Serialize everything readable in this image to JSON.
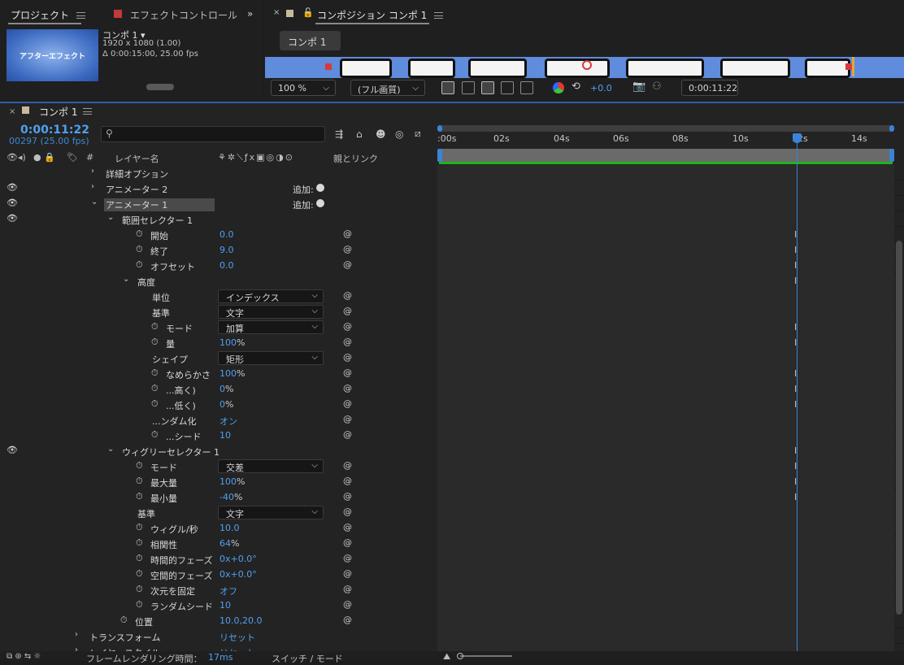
{
  "top_left": {
    "tab_project": "プロジェクト",
    "tab_effect_controls": "エフェクトコントロール",
    "effect_color": "#c23b3b",
    "thumbnail_text": "アフターエフェクト",
    "comp_name": "コンポ 1 ▾",
    "comp_size": "1920 x 1080 (1.00)",
    "comp_duration": "Δ 0:00:15:00, 25.00 fps"
  },
  "viewer": {
    "tab_close": "×",
    "tab_label": "コンポジション コンポ 1",
    "comp_button": "コンポ 1",
    "zoom": "100 %",
    "quality": "(フル画質)",
    "exposure": "+0.0",
    "timecode": "0:00:11:22"
  },
  "timeline": {
    "tab_close": "×",
    "tab_label": "コンポ 1",
    "timecode": "0:00:11:22",
    "frames": "00297 (25.00 fps)",
    "search_icon": "search-icon",
    "headers": {
      "layer_name": "レイヤー名",
      "hash": "#",
      "parent_link": "親とリンク"
    },
    "ruler_labels": [
      ":00s",
      "02s",
      "04s",
      "06s",
      "08s",
      "10s",
      "12s",
      "14s"
    ],
    "playhead_seconds": 11.88
  },
  "rows": {
    "r0": {
      "name": "詳細オプション"
    },
    "r1": {
      "name": "アニメーター 2",
      "add": "追加:"
    },
    "r2": {
      "name": "アニメーター 1",
      "add": "追加:"
    },
    "r3": {
      "name": "範囲セレクター 1"
    },
    "r4": {
      "name": "開始",
      "value": "0.0"
    },
    "r5": {
      "name": "終了",
      "value": "9.0"
    },
    "r6": {
      "name": "オフセット",
      "value": "0.0"
    },
    "r7": {
      "name": "高度"
    },
    "r8": {
      "name": "単位",
      "value": "インデックス"
    },
    "r9": {
      "name": "基準",
      "value": "文字"
    },
    "r10": {
      "name": "モード",
      "value": "加算"
    },
    "r11": {
      "name": "量",
      "value": "100",
      "unit": "%"
    },
    "r12": {
      "name": "シェイプ",
      "value": "矩形"
    },
    "r13": {
      "name": "なめらかさ",
      "value": "100",
      "unit": "%"
    },
    "r14": {
      "name": "...高く)",
      "value": "0",
      "unit": "%"
    },
    "r15": {
      "name": "...低く)",
      "value": "0",
      "unit": "%"
    },
    "r16": {
      "name": "...ンダム化",
      "value": "オン"
    },
    "r17": {
      "name": "...シード",
      "value": "10"
    },
    "r18": {
      "name": "ウィグリーセレクター 1"
    },
    "r19": {
      "name": "モード",
      "value": "交差"
    },
    "r20": {
      "name": "最大量",
      "value": "100",
      "unit": "%"
    },
    "r21": {
      "name": "最小量",
      "value": "-40",
      "unit": "%"
    },
    "r22": {
      "name": "基準",
      "value": "文字"
    },
    "r23": {
      "name": "ウィグル/秒",
      "value": "10.0"
    },
    "r24": {
      "name": "相関性",
      "value": "64",
      "unit": "%"
    },
    "r25": {
      "name": "時間的フェーズ",
      "value": "0x+0.0°"
    },
    "r26": {
      "name": "空間的フェーズ",
      "value": "0x+0.0°"
    },
    "r27": {
      "name": "次元を固定",
      "value": "オフ"
    },
    "r28": {
      "name": "ランダムシード",
      "value": "10"
    },
    "r29": {
      "name": "位置",
      "value": "10.0,20.0"
    },
    "r30": {
      "name": "トランスフォーム",
      "value": "リセット"
    },
    "r31": {
      "name": "レイヤースタイル",
      "value": "リセット"
    }
  },
  "bottom": {
    "render_time_label": "フレームレンダリング時間：",
    "render_time_value": "17ms",
    "switch_mode": "スイッチ / モード"
  }
}
